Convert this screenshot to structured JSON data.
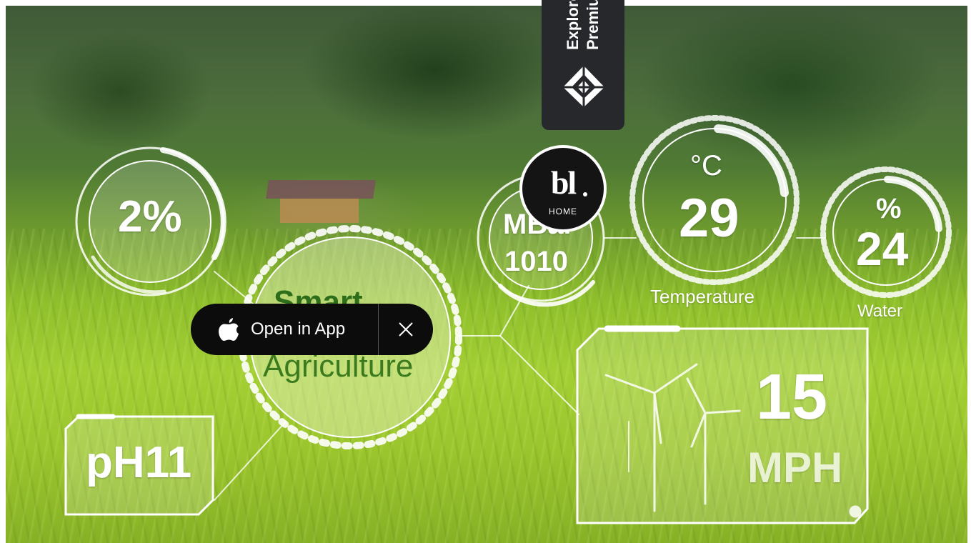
{
  "hero": {
    "ph_label": "pH11",
    "humidity_label": "2%",
    "pressure_unit": "MBar",
    "pressure_value": "1010",
    "temperature_unit": "°C",
    "temperature_value": "29",
    "temperature_caption": "Temperature",
    "water_unit": "%",
    "water_value": "24",
    "water_caption": "Water",
    "wind_value": "15",
    "wind_unit": "MPH",
    "center_line1": "Smart",
    "center_line2": "Agriculture"
  },
  "premium_tab": {
    "line1": "Explore",
    "line2": "Premium",
    "icon": "diamond-logo-icon"
  },
  "badge": {
    "logo": "bl",
    "label": "HOME"
  },
  "app_banner": {
    "open_label": "Open in App",
    "apple_icon": "apple-icon",
    "close_icon": "close-icon"
  },
  "colors": {
    "banner_bg": "#0c0c0c",
    "tab_bg": "#27282c",
    "overlay_white": "#ffffff",
    "accent_green": "#3b7a1e"
  }
}
